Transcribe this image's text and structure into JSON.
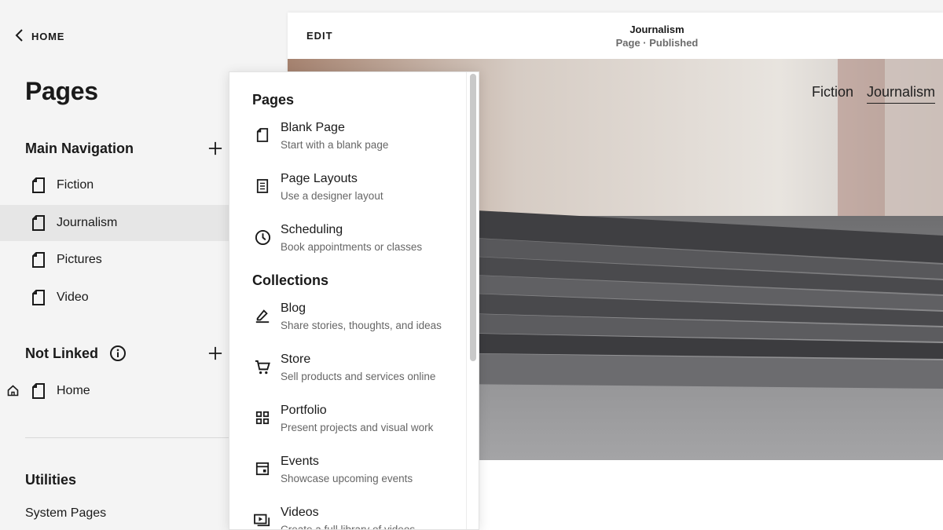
{
  "sidebar": {
    "back_label": "HOME",
    "title": "Pages",
    "main_nav": {
      "heading": "Main Navigation",
      "items": [
        {
          "label": "Fiction"
        },
        {
          "label": "Journalism"
        },
        {
          "label": "Pictures"
        },
        {
          "label": "Video"
        }
      ]
    },
    "not_linked": {
      "heading": "Not Linked",
      "items": [
        {
          "label": "Home"
        }
      ]
    },
    "utilities": {
      "heading": "Utilities",
      "items": [
        {
          "label": "System Pages"
        }
      ]
    }
  },
  "preview": {
    "edit_label": "EDIT",
    "page_name": "Journalism",
    "page_status": "Page · Published",
    "site_nav": [
      "Fiction",
      "Journalism"
    ]
  },
  "add_menu": {
    "groups": [
      {
        "heading": "Pages",
        "items": [
          {
            "title": "Blank Page",
            "subtitle": "Start with a blank page",
            "icon": "blank-page-icon"
          },
          {
            "title": "Page Layouts",
            "subtitle": "Use a designer layout",
            "icon": "layout-icon"
          },
          {
            "title": "Scheduling",
            "subtitle": "Book appointments or classes",
            "icon": "clock-icon"
          }
        ]
      },
      {
        "heading": "Collections",
        "items": [
          {
            "title": "Blog",
            "subtitle": "Share stories, thoughts, and ideas",
            "icon": "pen-icon"
          },
          {
            "title": "Store",
            "subtitle": "Sell products and services online",
            "icon": "cart-icon"
          },
          {
            "title": "Portfolio",
            "subtitle": "Present projects and visual work",
            "icon": "grid-icon"
          },
          {
            "title": "Events",
            "subtitle": "Showcase upcoming events",
            "icon": "calendar-icon"
          },
          {
            "title": "Videos",
            "subtitle": "Create a full library of videos",
            "icon": "video-library-icon"
          }
        ]
      }
    ]
  },
  "colors": {
    "sidebar_bg": "#f4f4f4",
    "active_item_bg": "#e6e6e6",
    "text": "#1a1a1a",
    "muted_text": "#666666"
  }
}
